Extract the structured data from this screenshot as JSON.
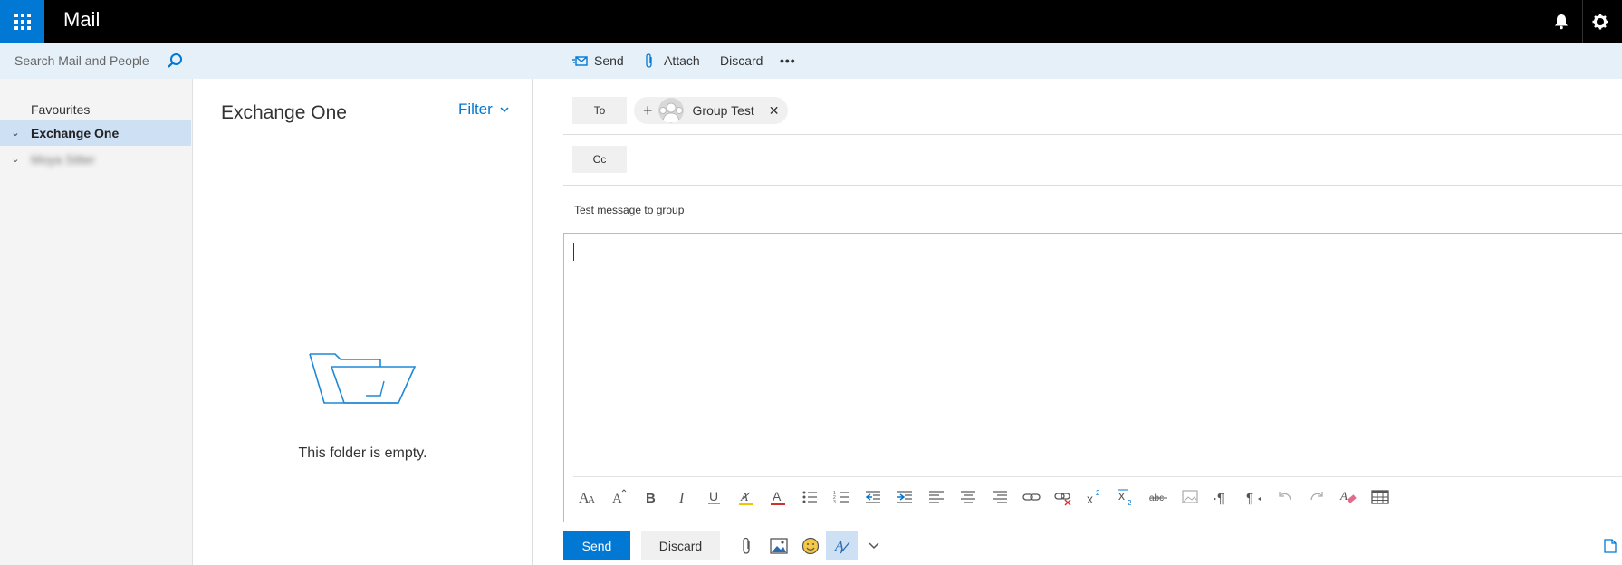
{
  "app": {
    "title": "Mail"
  },
  "search": {
    "placeholder": "Search Mail and People"
  },
  "nav": {
    "favourites_label": "Favourites",
    "items": [
      {
        "label": "Exchange One",
        "selected": true
      },
      {
        "label": "Moya Sitter",
        "blurred": true
      }
    ]
  },
  "commands": {
    "send": "Send",
    "attach": "Attach",
    "discard": "Discard",
    "more": "•••"
  },
  "folder": {
    "title": "Exchange One",
    "filter_label": "Filter",
    "empty_message": "This folder is empty."
  },
  "compose": {
    "to_label": "To",
    "cc_label": "Cc",
    "recipient": "Group Test",
    "subject": "Test message to group",
    "send_label": "Send",
    "discard_label": "Discard"
  },
  "colors": {
    "accent": "#0078d4",
    "topbar": "#000000",
    "selection": "#cde0f4",
    "header_strip": "#e6f0f8"
  }
}
